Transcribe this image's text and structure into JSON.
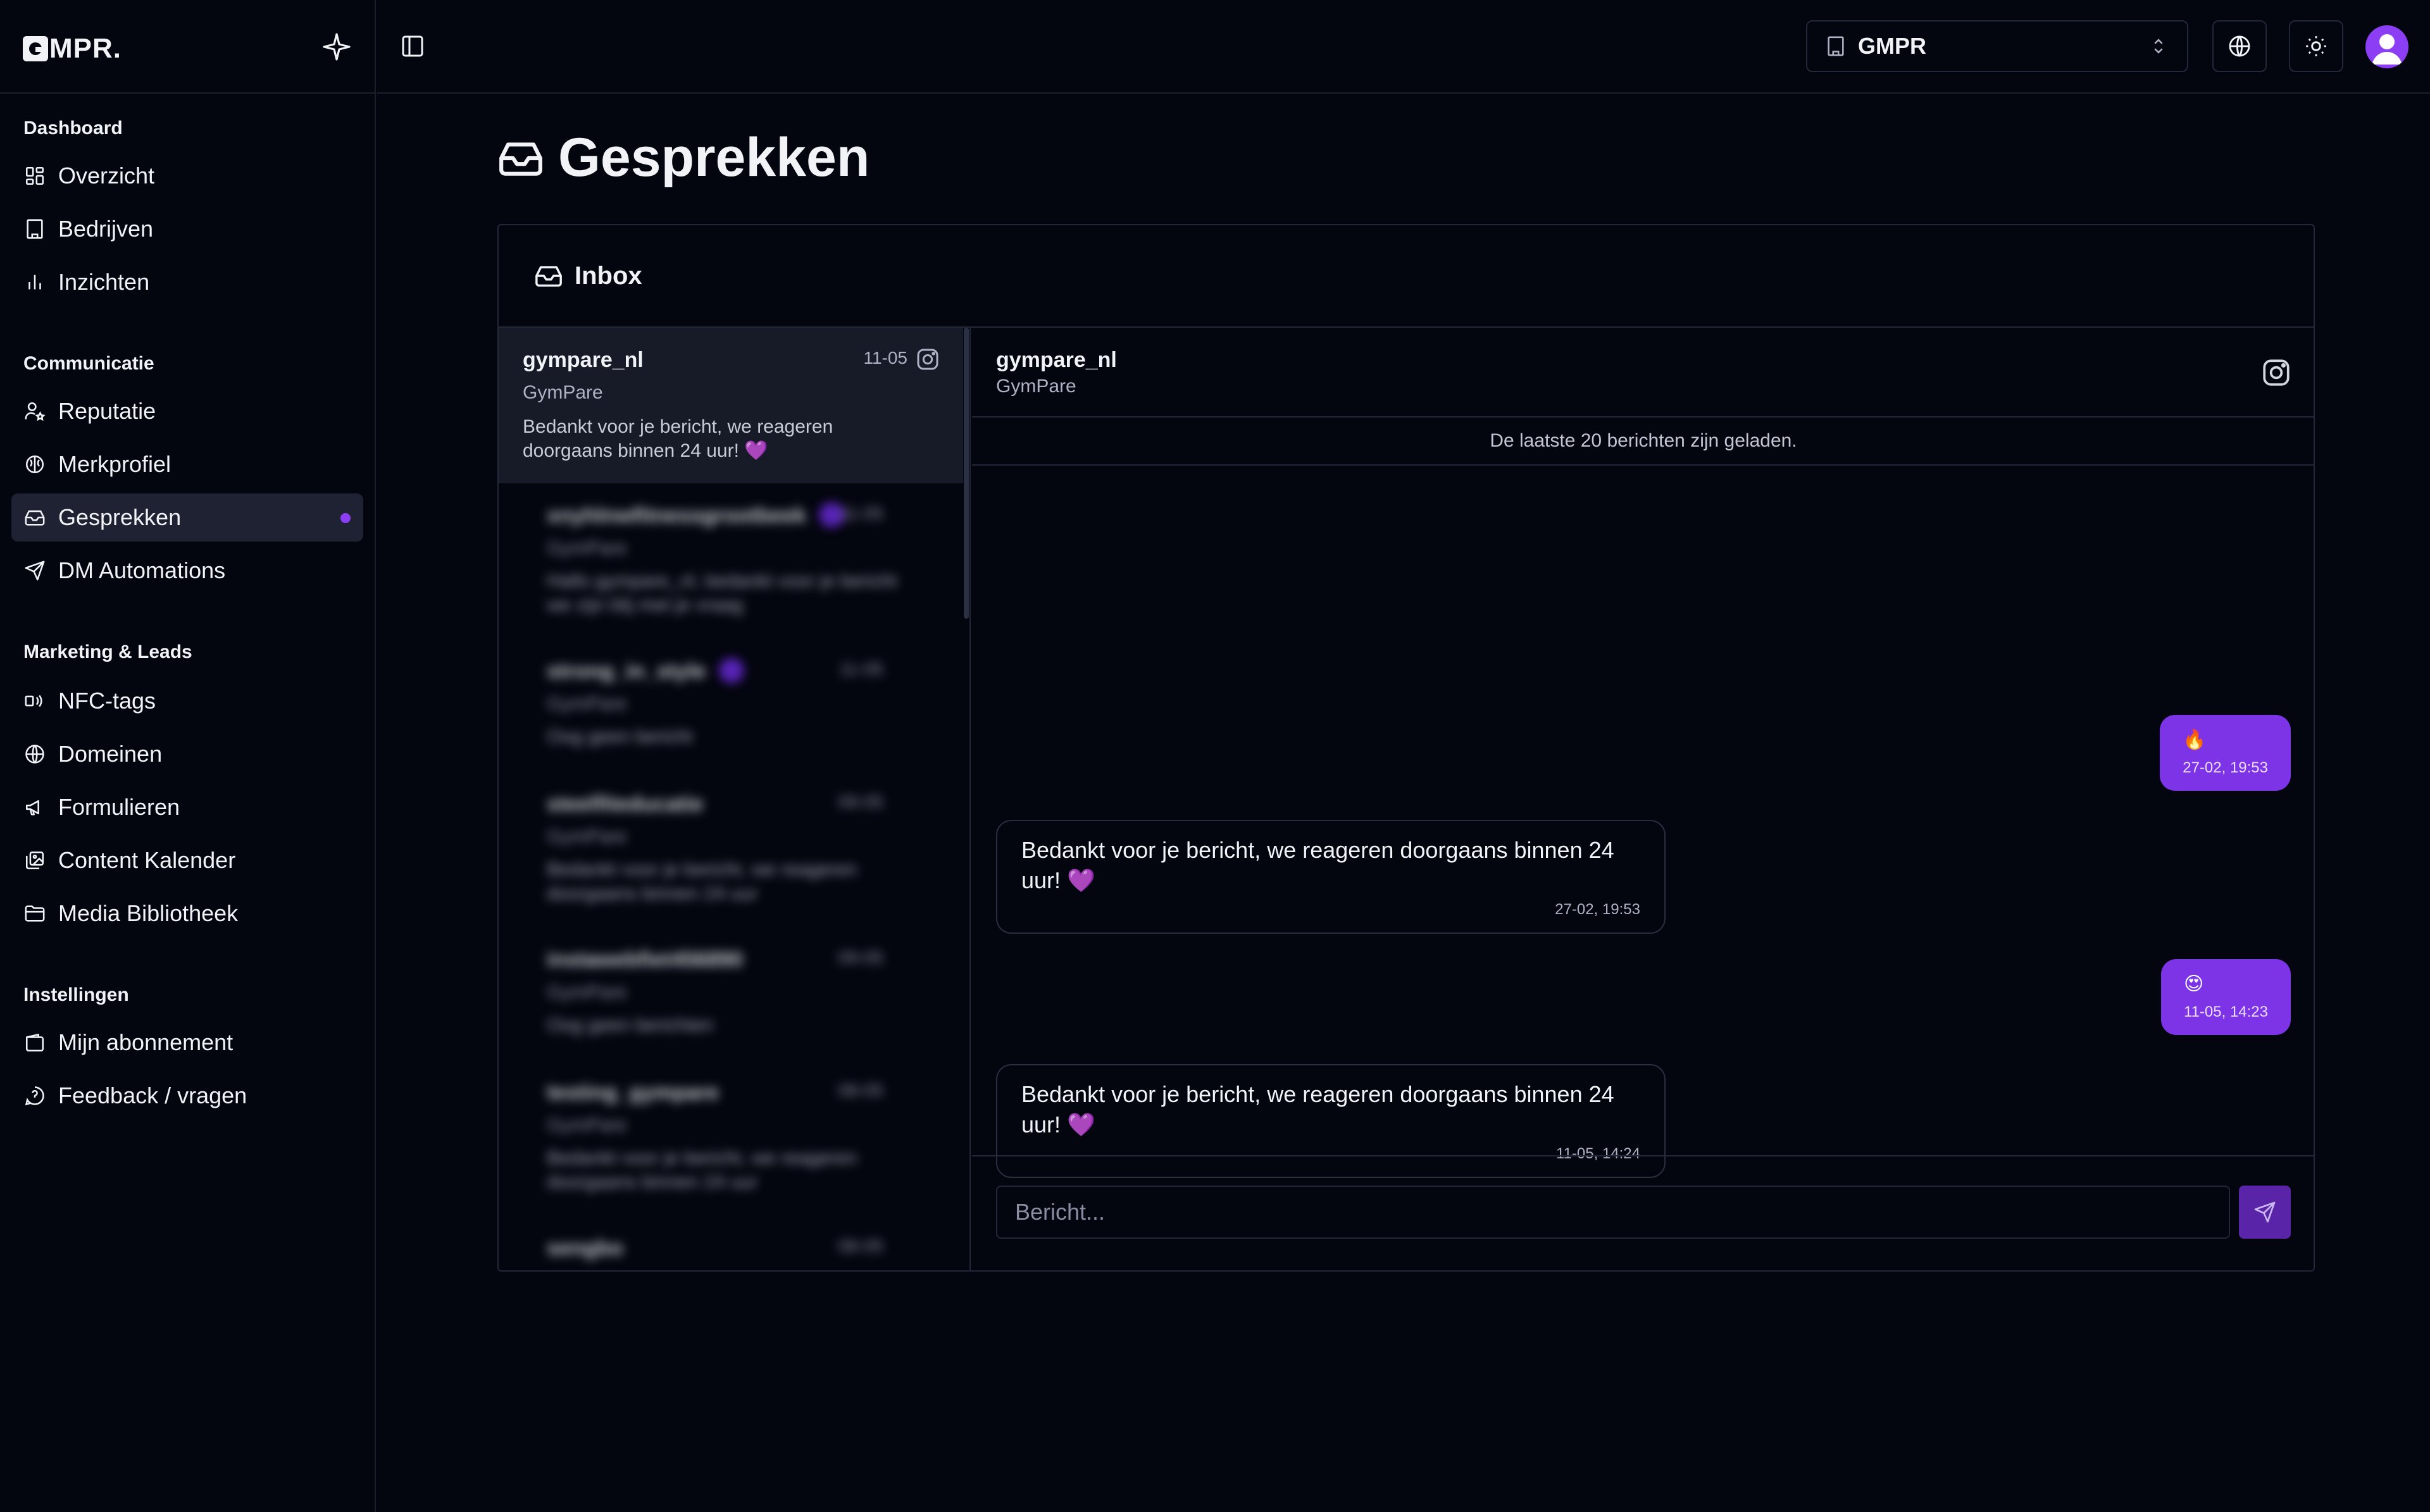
{
  "brand": {
    "logo_text": "MPR."
  },
  "sidebar": {
    "groups": [
      {
        "title": "Dashboard",
        "items": [
          {
            "label": "Overzicht",
            "icon": "layout-dashboard-icon"
          },
          {
            "label": "Bedrijven",
            "icon": "building-icon"
          },
          {
            "label": "Inzichten",
            "icon": "bar-chart-icon"
          }
        ]
      },
      {
        "title": "Communicatie",
        "items": [
          {
            "label": "Reputatie",
            "icon": "user-star-icon"
          },
          {
            "label": "Merkprofiel",
            "icon": "brain-icon"
          },
          {
            "label": "Gesprekken",
            "icon": "inbox-icon",
            "active": true
          },
          {
            "label": "DM Automations",
            "icon": "send-icon"
          }
        ]
      },
      {
        "title": "Marketing & Leads",
        "items": [
          {
            "label": "NFC-tags",
            "icon": "nfc-icon"
          },
          {
            "label": "Domeinen",
            "icon": "globe-icon"
          },
          {
            "label": "Formulieren",
            "icon": "megaphone-icon"
          },
          {
            "label": "Content Kalender",
            "icon": "images-icon"
          },
          {
            "label": "Media Bibliotheek",
            "icon": "folder-icon"
          }
        ]
      },
      {
        "title": "Instellingen",
        "items": [
          {
            "label": "Mijn abonnement",
            "icon": "wallet-icon"
          },
          {
            "label": "Feedback / vragen",
            "icon": "message-question-icon"
          }
        ]
      }
    ]
  },
  "topbar": {
    "company": "GMPR"
  },
  "page": {
    "title": "Gesprekken"
  },
  "inbox": {
    "title": "Inbox",
    "conversations": [
      {
        "name": "gympare_nl",
        "sub": "GymPare",
        "preview": "Bedankt voor je bericht, we reageren doorgaans binnen 24 uur! 💜",
        "date": "11-05",
        "selected": true
      },
      {
        "name": "xnyhlnwfitnessgrootbeek",
        "sub": "GymPare",
        "preview": "Hallo gympare_nl, bedankt voor je bericht we zijn blij met je vraag",
        "date": "11-05",
        "badge": true
      },
      {
        "name": "strong_in_style",
        "sub": "GymPare",
        "preview": "Oog geen bericht",
        "date": "11-05",
        "badge": true
      },
      {
        "name": "steelfiteducatie",
        "sub": "GymPare",
        "preview": "Bedankt voor je bericht, we reageren doorgaans binnen 24 uur",
        "date": "09-05"
      },
      {
        "name": "instawebfiet456890",
        "sub": "GymPare",
        "preview": "Oog geen berichten",
        "date": "09-05"
      },
      {
        "name": "testing_gympare",
        "sub": "GymPare",
        "preview": "Bedankt voor je bericht, we reageren doorgaans binnen 24 uur",
        "date": "08-05"
      },
      {
        "name": "sengbo",
        "sub": "GymPare",
        "preview": "",
        "date": "08-05"
      }
    ]
  },
  "chat": {
    "name": "gympare_nl",
    "sub": "GymPare",
    "loaded_note": "De laatste 20 berichten zijn geladen.",
    "messages": [
      {
        "dir": "out",
        "text": "🔥",
        "time": "27-02, 19:53"
      },
      {
        "dir": "in",
        "text": "Bedankt voor je bericht, we reageren doorgaans binnen 24 uur! 💜",
        "time": "27-02, 19:53"
      },
      {
        "dir": "out",
        "text": "😍",
        "time": "11-05, 14:23"
      },
      {
        "dir": "in",
        "text": "Bedankt voor je bericht, we reageren doorgaans binnen 24 uur! 💜",
        "time": "11-05, 14:24"
      }
    ],
    "composer_placeholder": "Bericht..."
  }
}
